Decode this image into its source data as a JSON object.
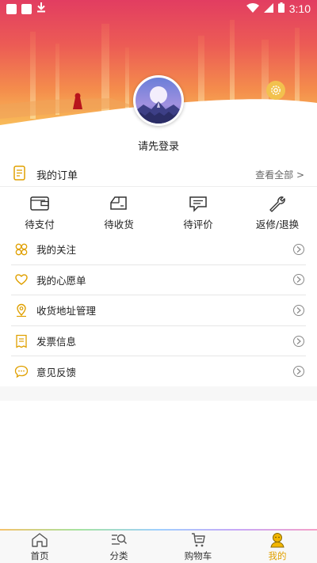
{
  "status_bar": {
    "time": "3:10"
  },
  "profile": {
    "login_prompt": "请先登录"
  },
  "orders": {
    "title": "我的订单",
    "view_all": "查看全部 >",
    "items": [
      {
        "label": "待支付",
        "icon": "wallet-icon"
      },
      {
        "label": "待收货",
        "icon": "delivery-icon"
      },
      {
        "label": "待评价",
        "icon": "comment-icon"
      },
      {
        "label": "返修/退换",
        "icon": "wrench-icon"
      }
    ]
  },
  "menu": [
    {
      "label": "我的关注",
      "icon": "clover-icon"
    },
    {
      "label": "我的心愿单",
      "icon": "heart-icon"
    },
    {
      "label": "收货地址管理",
      "icon": "location-icon"
    },
    {
      "label": "发票信息",
      "icon": "invoice-icon"
    },
    {
      "label": "意见反馈",
      "icon": "feedback-icon"
    }
  ],
  "tabbar": {
    "tabs": [
      {
        "label": "首页",
        "icon": "home-icon"
      },
      {
        "label": "分类",
        "icon": "category-search-icon"
      },
      {
        "label": "购物车",
        "icon": "cart-icon"
      },
      {
        "label": "我的",
        "icon": "profile-icon",
        "active": true
      }
    ]
  },
  "colors": {
    "accent": "#e0a000",
    "banner_top": "#e8455a",
    "banner_bottom": "#f9c05a"
  }
}
